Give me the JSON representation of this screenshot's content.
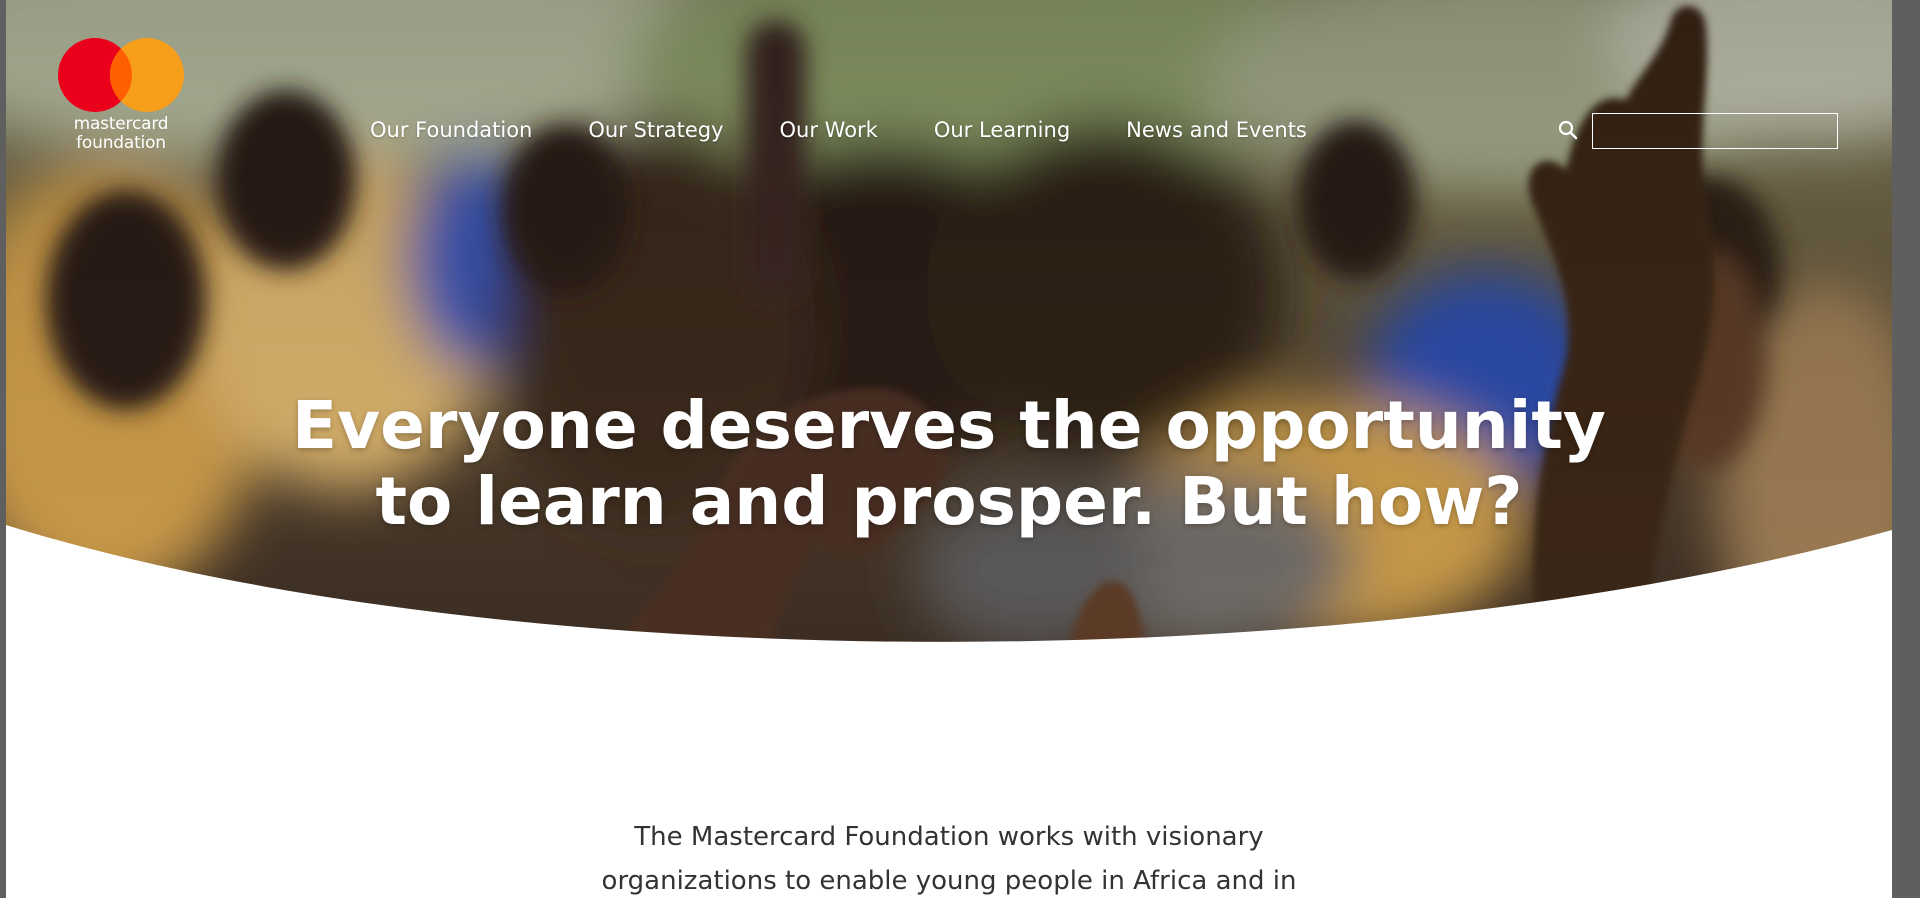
{
  "brand": {
    "logo_line1": "mastercard",
    "logo_line2": "foundation",
    "circle_left_color": "#EB001B",
    "circle_right_color": "#F79E1B",
    "overlap_color": "#FF5F00"
  },
  "nav": {
    "items": [
      {
        "label": "Our Foundation"
      },
      {
        "label": "Our Strategy"
      },
      {
        "label": "Our Work"
      },
      {
        "label": "Our Learning"
      },
      {
        "label": "News and Events"
      }
    ],
    "search_icon": "search-icon",
    "search_value": ""
  },
  "hero": {
    "headline_line1": "Everyone deserves the opportunity",
    "headline_line2": "to learn and prosper. But how?"
  },
  "intro": {
    "line1": "The Mastercard Foundation works with visionary",
    "line2": "organizations to enable young people in Africa and in"
  }
}
